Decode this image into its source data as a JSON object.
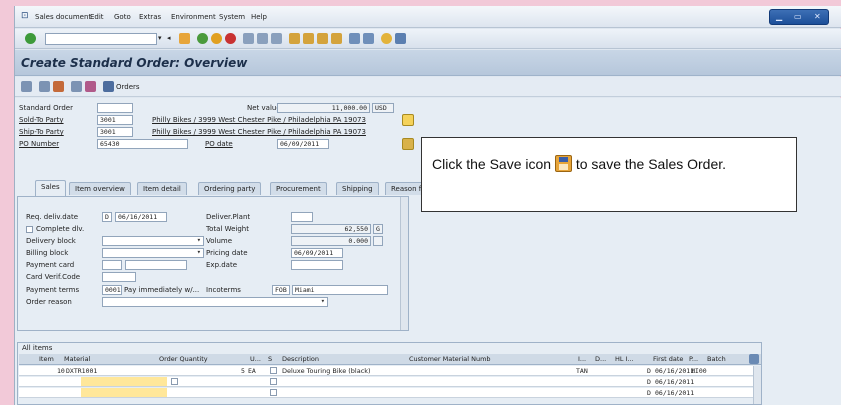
{
  "menu": [
    "Sales document",
    "Edit",
    "Goto",
    "Extras",
    "Environment",
    "System",
    "Help"
  ],
  "screen_title": "Create Standard Order: Overview",
  "toolbar2": {
    "orders_label": "Orders"
  },
  "header": {
    "standard_order_label": "Standard Order",
    "standard_order_value": "",
    "net_value_label": "Net value",
    "net_value": "11,000.00",
    "currency": "USD",
    "sold_to_label": "Sold-To Party",
    "sold_to_value": "3001",
    "sold_to_desc": "Philly Bikes / 3999 West Chester Pike / Philadelphia PA 19073",
    "ship_to_label": "Ship-To Party",
    "ship_to_value": "3001",
    "ship_to_desc": "Philly Bikes / 3999 West Chester Pike / Philadelphia PA 19073",
    "po_number_label": "PO Number",
    "po_number_value": "65430",
    "po_date_label": "PO date",
    "po_date_value": "06/09/2011"
  },
  "tabs": [
    "Sales",
    "Item overview",
    "Item detail",
    "Ordering party",
    "Procurement",
    "Shipping",
    "Reason f"
  ],
  "sales_tab": {
    "req_deliv_date_label": "Req. deliv.date",
    "req_deliv_date_type": "D",
    "req_deliv_date": "06/16/2011",
    "deliver_plant_label": "Deliver.Plant",
    "complete_dlv_label": "Complete dlv.",
    "total_weight_label": "Total Weight",
    "total_weight": "62,550",
    "total_weight_unit": "G",
    "delivery_block_label": "Delivery block",
    "volume_label": "Volume",
    "volume": "0.000",
    "billing_block_label": "Billing block",
    "pricing_date_label": "Pricing date",
    "pricing_date": "06/09/2011",
    "payment_card_label": "Payment card",
    "exp_date_label": "Exp.date",
    "card_verif_label": "Card Verif.Code",
    "payment_terms_label": "Payment terms",
    "payment_terms_code": "0001",
    "payment_terms_desc": "Pay immediately w/...",
    "incoterms_label": "Incoterms",
    "incoterms_code": "FOB",
    "incoterms_place": "Miami",
    "order_reason_label": "Order reason"
  },
  "items": {
    "section_label": "All items",
    "columns": [
      "Item",
      "Material",
      "Order Quantity",
      "U...",
      "S",
      "Description",
      "Customer Material Numb",
      "I...",
      "D...",
      "HL I...",
      "First date",
      "P...",
      "Batch"
    ],
    "rows": [
      {
        "item": "10",
        "material": "DXTR1001",
        "qty": "5",
        "unit": "EA",
        "description": "Deluxe Touring Bike (black)",
        "category": "TAN",
        "date_type": "D",
        "first_date": "06/16/2011",
        "plant": "MI00"
      },
      {
        "item": "",
        "material": "",
        "qty": "",
        "unit": "",
        "description": "",
        "category": "",
        "date_type": "D",
        "first_date": "06/16/2011",
        "plant": ""
      },
      {
        "item": "",
        "material": "",
        "qty": "",
        "unit": "",
        "description": "",
        "category": "",
        "date_type": "D",
        "first_date": "06/16/2011",
        "plant": ""
      }
    ]
  },
  "callout": {
    "text_before": "Click the Save icon",
    "text_after": "to save the Sales Order."
  }
}
